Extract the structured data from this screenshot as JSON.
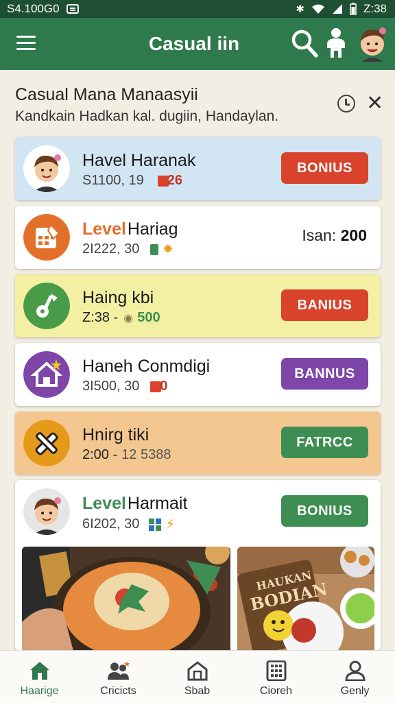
{
  "status_bar": {
    "time_left": "S4.100G0",
    "time_right": "Z:38"
  },
  "app_bar": {
    "title": "Casual iin"
  },
  "header": {
    "title": "Casual Mana Manaasyii",
    "subtitle": "Kandkain Hadkan kal. dugiin,  Handaylan."
  },
  "cards": [
    {
      "name": "Havel Haranak",
      "meta": "S1100, 19",
      "badge": "26",
      "button": "BONIUS",
      "bg": "#d2e5f2",
      "btn_color": "#d9432b"
    },
    {
      "name_prefix": "Level",
      "name": "Hariag",
      "meta": "2I222, 30",
      "right_label": "Isan:",
      "right_value": "200",
      "bg": "#ffffff"
    },
    {
      "name": "Haing kbi",
      "meta": "Z:38 -",
      "badge": "500",
      "button": "BANIUS",
      "bg": "#f3f0a3",
      "btn_color": "#d9432b"
    },
    {
      "name": "Haneh Conmdigi",
      "meta": "3I500, 30",
      "badge": "0",
      "button": "BANNUS",
      "bg": "#ffffff",
      "btn_color": "#7e46a8"
    },
    {
      "name": "Hnirg tiki",
      "meta": "2:00 -",
      "badge": "12 5388",
      "button": "FATRCC",
      "bg": "#f3c78f",
      "btn_color": "#3e8e53"
    },
    {
      "name_prefix": "Level",
      "name": "Harmait",
      "meta": "6I202, 30",
      "button": "BONIUS",
      "bg": "#ffffff",
      "btn_color": "#3e8e53"
    }
  ],
  "promo": {
    "sign_line1": "HAUKAN",
    "sign_line2": "BODIAN"
  },
  "bottom_nav": [
    {
      "label": "Haarige",
      "icon": "home-icon",
      "active": true
    },
    {
      "label": "Cricicts",
      "icon": "people-icon"
    },
    {
      "label": "Sbab",
      "icon": "store-icon"
    },
    {
      "label": "Cioreh",
      "icon": "grid-icon"
    },
    {
      "label": "Genly",
      "icon": "profile-icon"
    }
  ],
  "colors": {
    "app_bar": "#2f7a4c",
    "status_bar": "#1f4f33",
    "accent_green": "#2f7a4c"
  }
}
